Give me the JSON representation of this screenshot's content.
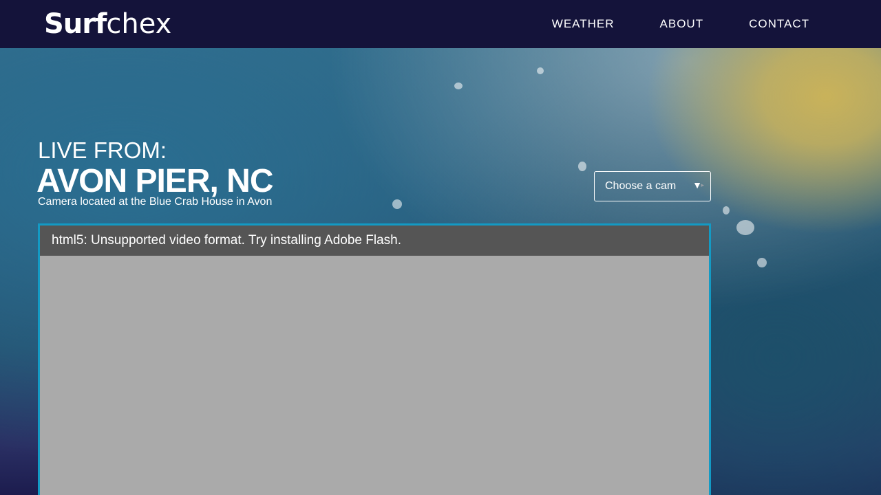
{
  "nav": {
    "logo_bold": "Surf",
    "logo_thin": "chex",
    "items": [
      "WEATHER",
      "ABOUT",
      "CONTACT"
    ]
  },
  "hero": {
    "eyebrow": "LIVE FROM:",
    "location": "AVON PIER, NC",
    "subtitle": "Camera located at the Blue Crab House in Avon"
  },
  "cam_selector": {
    "selected": "Choose a cam"
  },
  "player": {
    "message": "html5: Unsupported video format. Try installing Adobe Flash."
  },
  "colors": {
    "nav_bg": "#14133a",
    "player_border": "#139ac4",
    "player_bar": "#555555",
    "player_bg": "#aaaaaa"
  }
}
